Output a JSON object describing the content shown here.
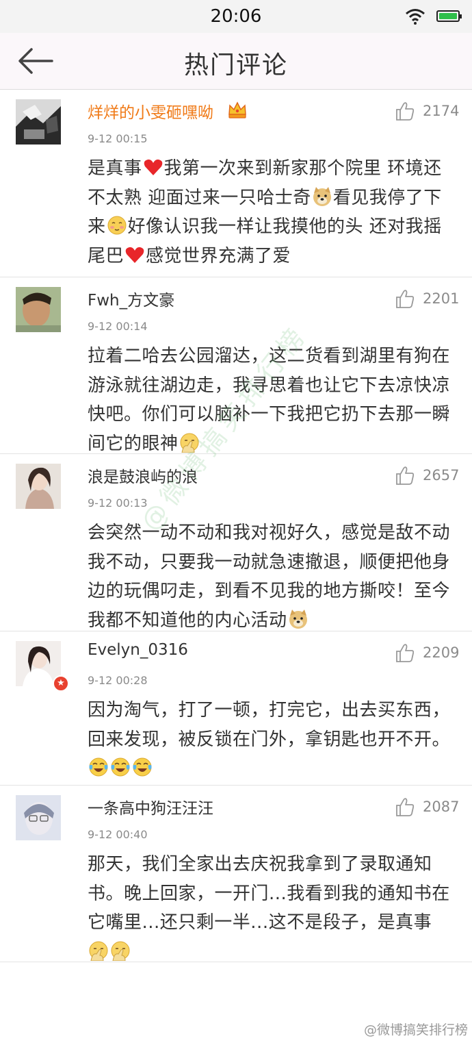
{
  "status_bar": {
    "time": "20:06"
  },
  "header": {
    "title": "热门评论"
  },
  "comments": [
    {
      "username": "烊烊的小雯砸嘿呦",
      "time": "9-12 00:15",
      "likes": "2174",
      "segments": [
        {
          "t": "是真事"
        },
        {
          "e": "heart-emoji"
        },
        {
          "t": "我第一次来到新家那个院里 环境还不太熟 迎面过来一只哈士奇"
        },
        {
          "e": "doge-emoji"
        },
        {
          "t": "看见我停了下来"
        },
        {
          "e": "blush-emoji"
        },
        {
          "t": "好像认识我一样让我摸他的头 还对我摇尾巴"
        },
        {
          "e": "heart-emoji"
        },
        {
          "t": "感觉世界充满了爱"
        }
      ]
    },
    {
      "username": "Fwh_方文豪",
      "time": "9-12 00:14",
      "likes": "2201",
      "segments": [
        {
          "t": "拉着二哈去公园溜达，这二货看到湖里有狗在游泳就往湖边走，我寻思着也让它下去凉快凉快吧。你们可以脑补一下我把它扔下去那一瞬间它的眼神"
        },
        {
          "e": "facepalm-emoji"
        }
      ]
    },
    {
      "username": "浪是鼓浪屿的浪",
      "time": "9-12 00:13",
      "likes": "2657",
      "segments": [
        {
          "t": "会突然一动不动和我对视好久，感觉是敌不动我不动，只要我一动就急速撤退，顺便把他身边的玩偶叼走，到看不见我的地方撕咬！至今我都不知道他的内心活动"
        },
        {
          "e": "doge-emoji"
        }
      ]
    },
    {
      "username": "Evelyn_0316",
      "time": "9-12 00:28",
      "likes": "2209",
      "segments": [
        {
          "t": "因为淘气，打了一顿，打完它，出去买东西，回来发现，被反锁在门外，拿钥匙也开不开。"
        },
        {
          "e": "laugh-cry-emoji"
        },
        {
          "e": "laugh-cry-emoji"
        },
        {
          "e": "laugh-cry-emoji"
        }
      ]
    },
    {
      "username": "一条高中狗汪汪汪",
      "time": "9-12 00:40",
      "likes": "2087",
      "segments": [
        {
          "t": "那天，我们全家出去庆祝我拿到了录取通知书。晚上回家，一开门...我看到我的通知书在它嘴里...还只剩一半...这不是段子，是真事"
        },
        {
          "e": "facepalm-emoji"
        },
        {
          "e": "facepalm-emoji"
        }
      ]
    }
  ],
  "watermark": {
    "diagonal": "@微博搞笑排行榜",
    "corner": "@微博搞笑排行榜"
  },
  "colors": {
    "vip_name": "#f07a17",
    "badge": "#e8412f"
  }
}
